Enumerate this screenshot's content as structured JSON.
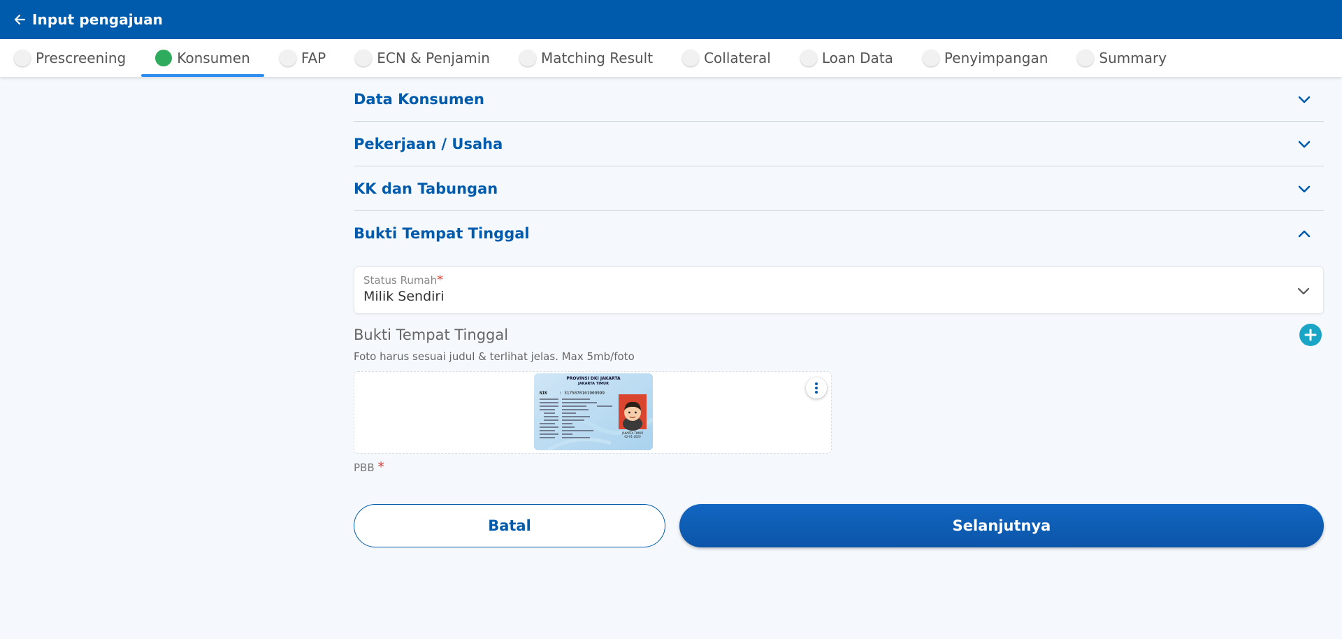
{
  "header": {
    "title": "Input pengajuan",
    "back_icon": "arrow-left-icon",
    "bg_color": "#005bac"
  },
  "tabs": [
    {
      "label": "Prescreening",
      "active": false
    },
    {
      "label": "Konsumen",
      "active": true
    },
    {
      "label": "FAP",
      "active": false
    },
    {
      "label": "ECN & Penjamin",
      "active": false
    },
    {
      "label": "Matching Result",
      "active": false
    },
    {
      "label": "Collateral",
      "active": false
    },
    {
      "label": "Loan Data",
      "active": false
    },
    {
      "label": "Penyimpangan",
      "active": false
    },
    {
      "label": "Summary",
      "active": false
    }
  ],
  "sections": [
    {
      "title": "Data Konsumen",
      "expanded": false
    },
    {
      "title": "Pekerjaan / Usaha",
      "expanded": false
    },
    {
      "title": "KK dan Tabungan",
      "expanded": false
    },
    {
      "title": "Bukti Tempat Tinggal",
      "expanded": true
    }
  ],
  "status_rumah": {
    "label": "Status Rumah",
    "required_mark": "*",
    "value": "Milik Sendiri"
  },
  "upload": {
    "title": "Bukti Tempat Tinggal",
    "hint": "Foto harus sesuai judul & terlihat jelas. Max 5mb/foto",
    "add_icon": "plus-circle-icon",
    "menu_icon": "more-vertical-icon",
    "card": {
      "header1": "PROVINSI DKI JAKARTA",
      "header2": "JAKARTA TIMUR",
      "nik_label": "NIK",
      "nik_value": ": 3175070101909999",
      "city": "JAKARTA TIMUR",
      "date": "02-01-2020"
    }
  },
  "pbb": {
    "label": "PBB",
    "required_mark": "*"
  },
  "actions": {
    "cancel_label": "Batal",
    "next_label": "Selanjutnya"
  }
}
